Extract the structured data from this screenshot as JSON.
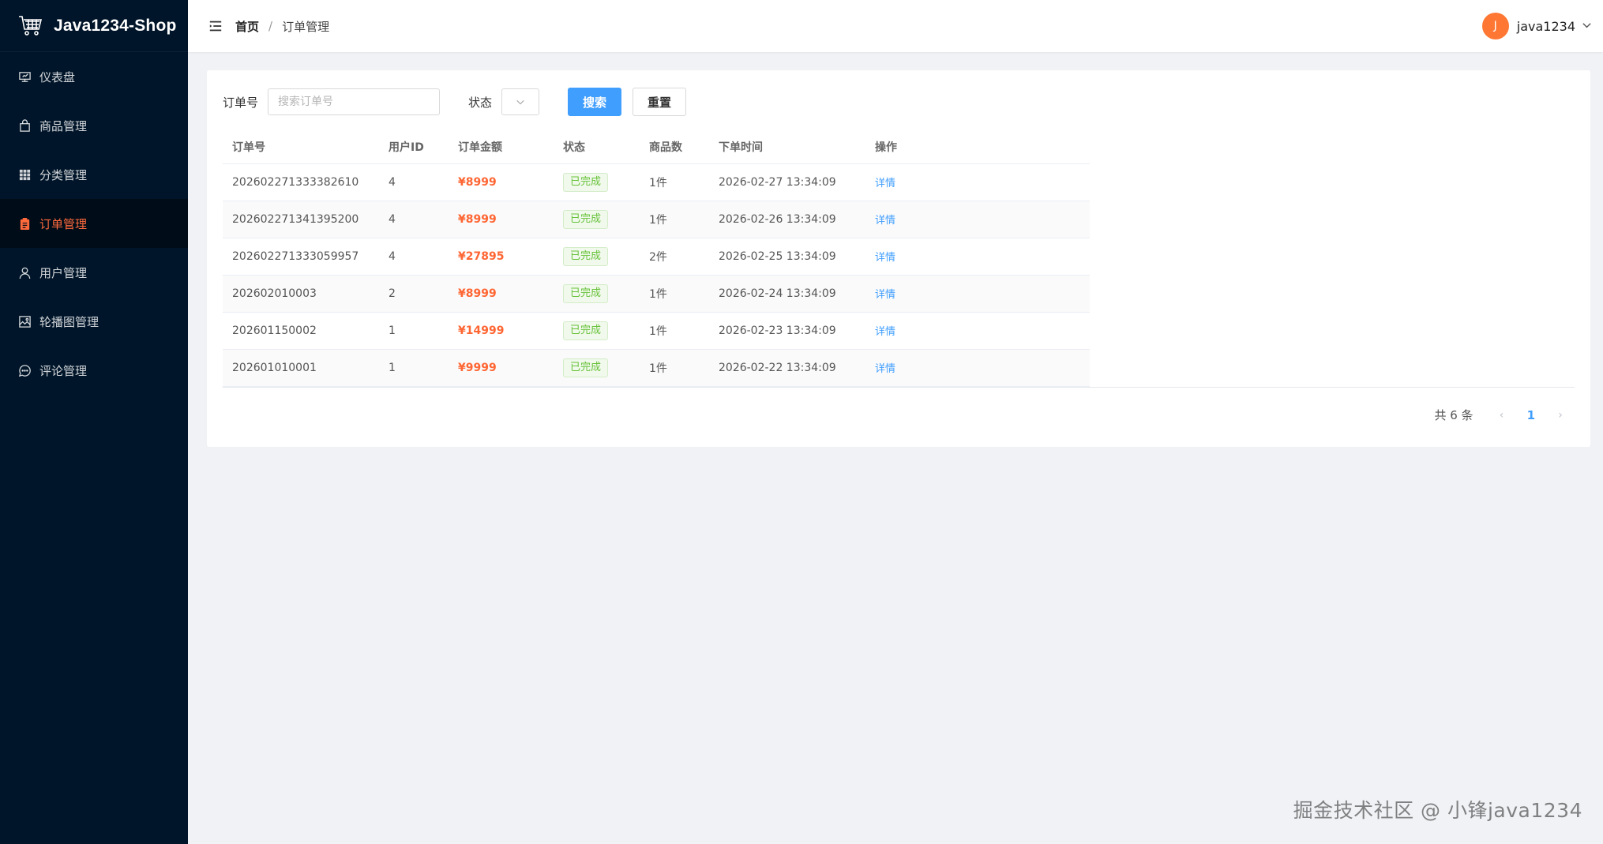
{
  "app": {
    "title": "Java1234-Shop"
  },
  "sidebar": {
    "items": [
      {
        "label": "仪表盘",
        "icon": "dashboard-icon",
        "active": false
      },
      {
        "label": "商品管理",
        "icon": "bag-icon",
        "active": false
      },
      {
        "label": "分类管理",
        "icon": "grid-icon",
        "active": false
      },
      {
        "label": "订单管理",
        "icon": "clipboard-icon",
        "active": true
      },
      {
        "label": "用户管理",
        "icon": "user-icon",
        "active": false
      },
      {
        "label": "轮播图管理",
        "icon": "image-icon",
        "active": false
      },
      {
        "label": "评论管理",
        "icon": "chat-icon",
        "active": false
      }
    ]
  },
  "header": {
    "breadcrumb_home": "首页",
    "breadcrumb_sep": "/",
    "breadcrumb_current": "订单管理",
    "avatar_letter": "J",
    "username": "java1234"
  },
  "filters": {
    "order_no_label": "订单号",
    "order_no_placeholder": "搜索订单号",
    "order_no_value": "",
    "status_label": "状态",
    "search_label": "搜索",
    "reset_label": "重置"
  },
  "table": {
    "columns": [
      "订单号",
      "用户ID",
      "订单金额",
      "状态",
      "商品数",
      "下单时间",
      "操作"
    ],
    "rows": [
      {
        "order_no": "202602271333382610",
        "user_id": "4",
        "amount": "¥8999",
        "status": "已完成",
        "count": "1件",
        "time": "2026-02-27 13:34:09",
        "action": "详情"
      },
      {
        "order_no": "202602271341395200",
        "user_id": "4",
        "amount": "¥8999",
        "status": "已完成",
        "count": "1件",
        "time": "2026-02-26 13:34:09",
        "action": "详情"
      },
      {
        "order_no": "202602271333059957",
        "user_id": "4",
        "amount": "¥27895",
        "status": "已完成",
        "count": "2件",
        "time": "2026-02-25 13:34:09",
        "action": "详情"
      },
      {
        "order_no": "202602010003",
        "user_id": "2",
        "amount": "¥8999",
        "status": "已完成",
        "count": "1件",
        "time": "2026-02-24 13:34:09",
        "action": "详情"
      },
      {
        "order_no": "202601150002",
        "user_id": "1",
        "amount": "¥14999",
        "status": "已完成",
        "count": "1件",
        "time": "2026-02-23 13:34:09",
        "action": "详情"
      },
      {
        "order_no": "202601010001",
        "user_id": "1",
        "amount": "¥9999",
        "status": "已完成",
        "count": "1件",
        "time": "2026-02-22 13:34:09",
        "action": "详情"
      }
    ]
  },
  "pagination": {
    "total_text": "共 6 条",
    "current_page": "1"
  },
  "watermark": "掘金技术社区 @ 小锋java1234",
  "colors": {
    "sidebar_bg": "#001529",
    "active_menu": "#ff6a3d",
    "primary": "#409eff",
    "amount": "#ff6633",
    "success": "#67c23a"
  }
}
